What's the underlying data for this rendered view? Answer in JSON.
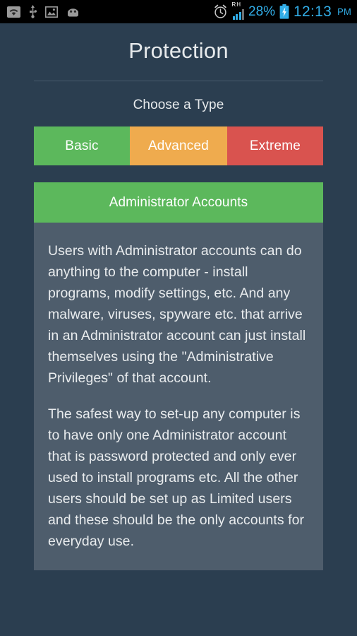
{
  "statusbar": {
    "left_icons": [
      "wifi-icon",
      "usb-icon",
      "screenshot-icon",
      "android-icon"
    ],
    "alarm_icon": "alarm-icon",
    "roaming_label": "RH",
    "battery_percent": "28%",
    "battery_icon": "battery-charging-icon",
    "time": "12:13",
    "ampm": "PM",
    "accent_color": "#32AEE8"
  },
  "header": {
    "title": "Protection"
  },
  "chooser": {
    "label": "Choose a Type",
    "tabs": [
      {
        "label": "Basic",
        "color": "#5CB85C",
        "selected": true
      },
      {
        "label": "Advanced",
        "color": "#EFAB4E",
        "selected": false
      },
      {
        "label": "Extreme",
        "color": "#D9534F",
        "selected": false
      }
    ]
  },
  "card": {
    "header_label": "Administrator Accounts",
    "header_color": "#5CB85C",
    "body_color": "#4E5D6C",
    "paragraphs": [
      "Users with Administrator accounts can do anything to the computer - install programs, modify settings, etc. And any malware, viruses, spyware etc. that arrive in an Administrator account can just install themselves using the \"Administrative Privileges\" of that account.",
      "The safest way to set-up any computer is to have only one Administrator account that is password protected and only ever used to install programs etc. All the other users should be set up as Limited users and these should be the only accounts for everyday use."
    ]
  },
  "theme": {
    "page_background": "#2B3E50",
    "text_color": "#E7EAEC",
    "divider_color": "#46586A"
  }
}
